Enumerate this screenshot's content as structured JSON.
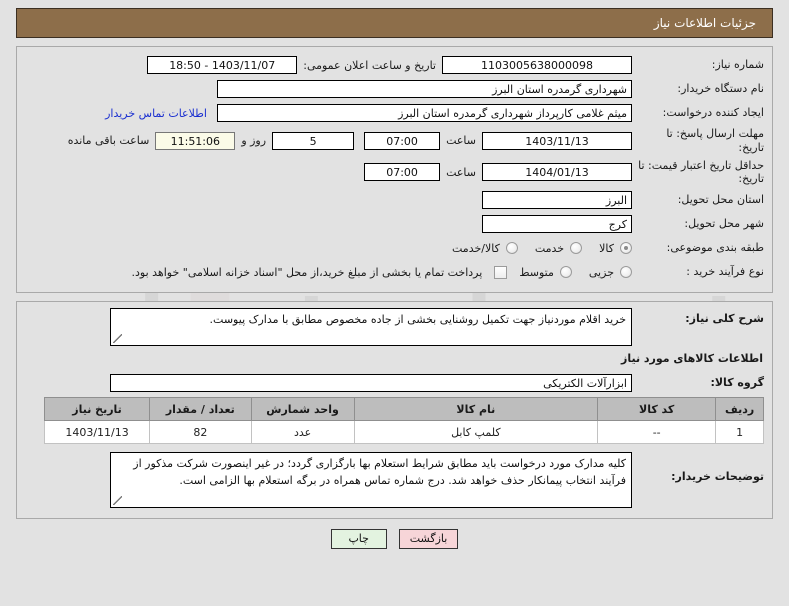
{
  "header": {
    "title": "جزئیات اطلاعات نیاز",
    "bar_color": "#8d6e4a"
  },
  "watermark": {
    "text": "urbantender.net"
  },
  "info": {
    "need_no_label": "شماره نیاز:",
    "need_no_value": "1103005638000098",
    "announce_label": "تاریخ و ساعت اعلان عمومی:",
    "announce_value": "1403/11/07 - 18:50",
    "buyer_org_label": "نام دستگاه خریدار:",
    "buyer_org_value": "شهرداری گرمدره استان البرز",
    "creator_label": "ایجاد کننده درخواست:",
    "creator_value": "میثم غلامی کارپرداز شهرداری گرمدره استان البرز",
    "contact_link": "اطلاعات تماس خریدار",
    "deadline_label": "مهلت ارسال پاسخ: تا تاریخ:",
    "deadline_date": "1403/11/13",
    "deadline_time_label": "ساعت",
    "deadline_time": "07:00",
    "remaining_days": "5",
    "remaining_days_label": "روز و",
    "remaining_timer": "11:51:06",
    "remaining_suffix": "ساعت باقی مانده",
    "validity_label": "حداقل تاریخ اعتبار قیمت: تا تاریخ:",
    "validity_date": "1404/01/13",
    "validity_time_label": "ساعت",
    "validity_time": "07:00",
    "province_label": "استان محل تحویل:",
    "province_value": "البرز",
    "city_label": "شهر محل تحویل:",
    "city_value": "کرج",
    "category_label": "طبقه بندی موضوعی:",
    "category_options": [
      {
        "label": "کالا",
        "selected": true
      },
      {
        "label": "خدمت",
        "selected": false
      },
      {
        "label": "کالا/خدمت",
        "selected": false
      }
    ],
    "process_label": "نوع فرآیند خرید :",
    "process_options": [
      {
        "label": "جزیی",
        "selected": false
      },
      {
        "label": "متوسط",
        "selected": false
      }
    ],
    "treasury_checkbox_text": "پرداخت تمام یا بخشی از مبلغ خرید،از محل \"اسناد خزانه اسلامی\" خواهد بود.",
    "treasury_checked": false
  },
  "description": {
    "label": "شرح کلی نیاز:",
    "value": "خرید اقلام موردنیاز جهت تکمیل روشنایی بخشی از جاده مخصوص مطابق با مدارک پیوست."
  },
  "goods": {
    "section_title": "اطلاعات کالاهای مورد نیاز",
    "group_label": "گروه کالا:",
    "group_value": "ابزارآلات الکتریکی",
    "columns": [
      "ردیف",
      "کد کالا",
      "نام کالا",
      "واحد شمارش",
      "تعداد / مقدار",
      "تاریخ نیاز"
    ],
    "rows": [
      {
        "row_no": "1",
        "code": "--",
        "name": "کلمپ کابل",
        "unit": "عدد",
        "qty": "82",
        "date": "1403/11/13"
      }
    ]
  },
  "notes": {
    "label": "توضیحات خریدار:",
    "value": "کلیه مدارک مورد درخواست باید مطابق شرایط استعلام بها بارگزاری گردد؛ در غیر اینصورت شرکت مذکور از فرآیند انتخاب پیمانکار حذف خواهد شد. درج شماره تماس همراه در برگه استعلام بها الزامی است."
  },
  "footer": {
    "back_label": "بازگشت",
    "print_label": "چاپ",
    "back_color": "#f7d5d8",
    "print_color": "#e3f3e0"
  }
}
